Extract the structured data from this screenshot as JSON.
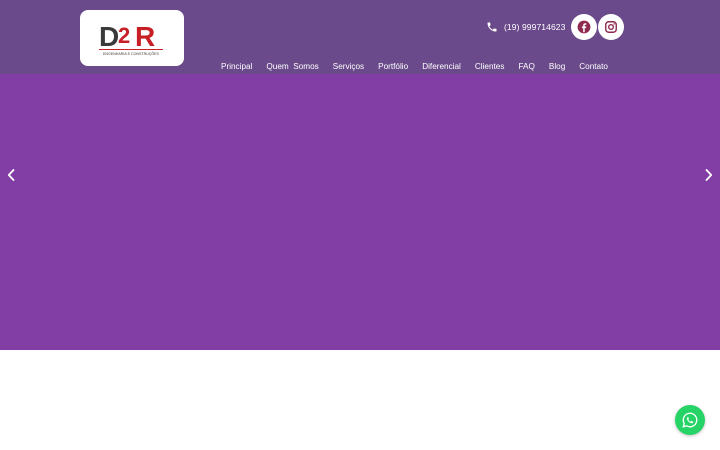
{
  "colors": {
    "header_bg": "#6a4a8a",
    "hero_bg": "#833ea6",
    "icon_accent": "#8e2a4e",
    "whatsapp": "#25d366"
  },
  "header": {
    "logo": {
      "mark": "D2R",
      "tagline": "ENGENHARIA E CONSTRUÇÕES",
      "icon": "d2r-logo"
    },
    "phone": {
      "icon": "phone-icon",
      "number": "(19) 999714623"
    },
    "social": [
      {
        "name": "facebook",
        "icon": "facebook-icon"
      },
      {
        "name": "instagram",
        "icon": "instagram-icon"
      }
    ],
    "nav": [
      {
        "label": "Principal"
      },
      {
        "label": "Quem  Somos"
      },
      {
        "label": "Serviços"
      },
      {
        "label": "Portfólio"
      },
      {
        "label": "Diferencial"
      },
      {
        "label": "Clientes"
      },
      {
        "label": "FAQ"
      },
      {
        "label": "Blog"
      },
      {
        "label": "Contato"
      }
    ]
  },
  "slider": {
    "prev_icon": "chevron-left-icon",
    "next_icon": "chevron-right-icon"
  },
  "floating": {
    "whatsapp_icon": "whatsapp-icon"
  }
}
